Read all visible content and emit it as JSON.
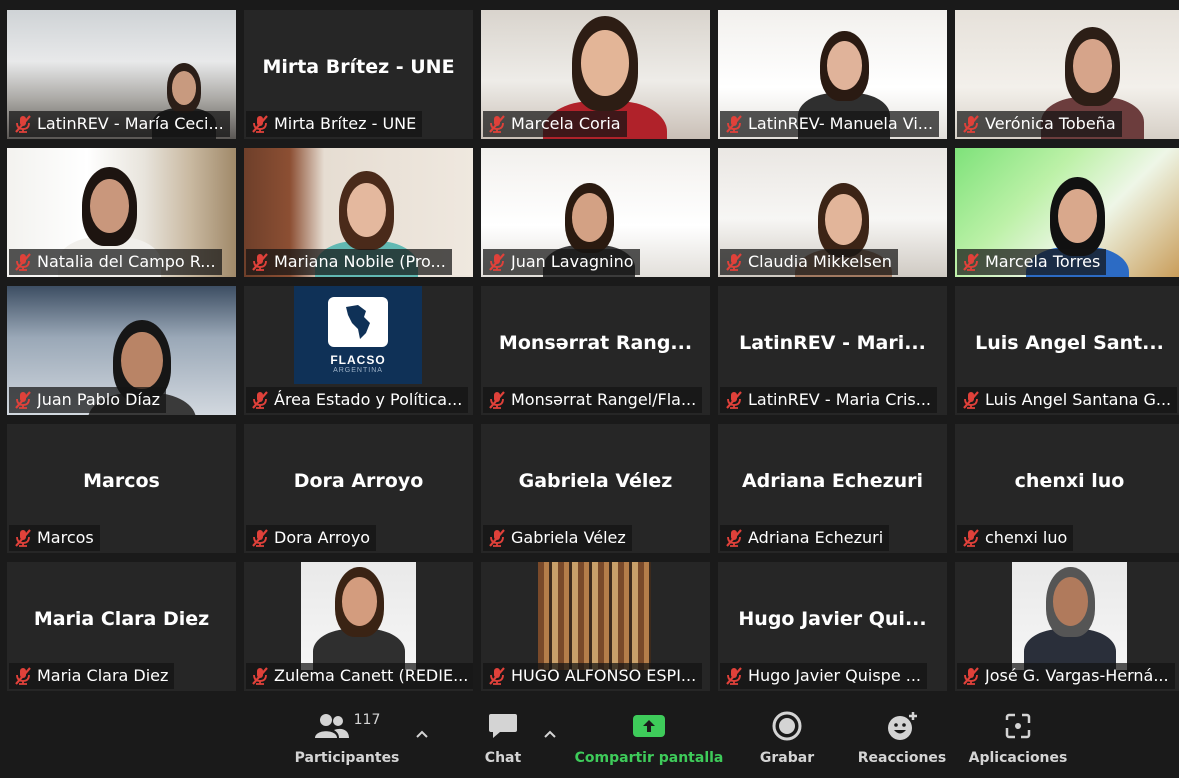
{
  "tiles": [
    {
      "big": "",
      "label": "LatinREV - María Ceci..."
    },
    {
      "big": "Mirta Brítez - UNE",
      "label": "Mirta Brítez - UNE"
    },
    {
      "big": "",
      "label": "Marcela Coria"
    },
    {
      "big": "",
      "label": "LatinREV- Manuela Vi..."
    },
    {
      "big": "",
      "label": "Verónica Tobeña",
      "active": true
    },
    {
      "big": "",
      "label": "Natalia del Campo R..."
    },
    {
      "big": "",
      "label": "Mariana Nobile (Pro..."
    },
    {
      "big": "",
      "label": "Juan Lavagnino"
    },
    {
      "big": "",
      "label": "Claudia Mikkelsen"
    },
    {
      "big": "",
      "label": "Marcela Torres"
    },
    {
      "big": "",
      "label": "Juan Pablo Díaz"
    },
    {
      "big": "",
      "label": "Área Estado y Política..."
    },
    {
      "big": "Monsərrat  Rang...",
      "label": "Monsərrat Rangel/Fla..."
    },
    {
      "big": "LatinREV  -  Mari...",
      "label": "LatinREV - Maria Cris..."
    },
    {
      "big": "Luis  Angel  Sant...",
      "label": "Luis Angel Santana G..."
    },
    {
      "big": "Marcos",
      "label": "Marcos"
    },
    {
      "big": "Dora Arroyo",
      "label": "Dora Arroyo"
    },
    {
      "big": "Gabriela Vélez",
      "label": "Gabriela Vélez"
    },
    {
      "big": "Adriana Echezuri",
      "label": "Adriana Echezuri"
    },
    {
      "big": "chenxi luo",
      "label": "chenxi luo"
    },
    {
      "big": "Maria Clara Diez",
      "label": "Maria Clara Diez"
    },
    {
      "big": "",
      "label": "Zulema Canett (REDIE..."
    },
    {
      "big": "",
      "label": "HUGO ALFONSO ESPI..."
    },
    {
      "big": "Hugo  Javier  Qui...",
      "label": "Hugo Javier Quispe ..."
    },
    {
      "big": "",
      "label": "José G. Vargas-Herná..."
    }
  ],
  "logo": {
    "name": "FLACSO",
    "sub": "ARGENTINA"
  },
  "toolbar": {
    "participants_label": "Participantes",
    "participants_count": "117",
    "chat_label": "Chat",
    "share_label": "Compartir pantalla",
    "record_label": "Grabar",
    "reactions_label": "Reacciones",
    "apps_label": "Aplicaciones"
  },
  "colors": {
    "active_border": "#d8e36a",
    "share_green": "#3ecb5a",
    "muted_red": "#e0413a"
  },
  "icons": [
    "mic-muted-icon",
    "participants-icon",
    "chat-icon",
    "share-screen-icon",
    "record-icon",
    "reactions-icon",
    "apps-icon",
    "caret-up-icon"
  ]
}
